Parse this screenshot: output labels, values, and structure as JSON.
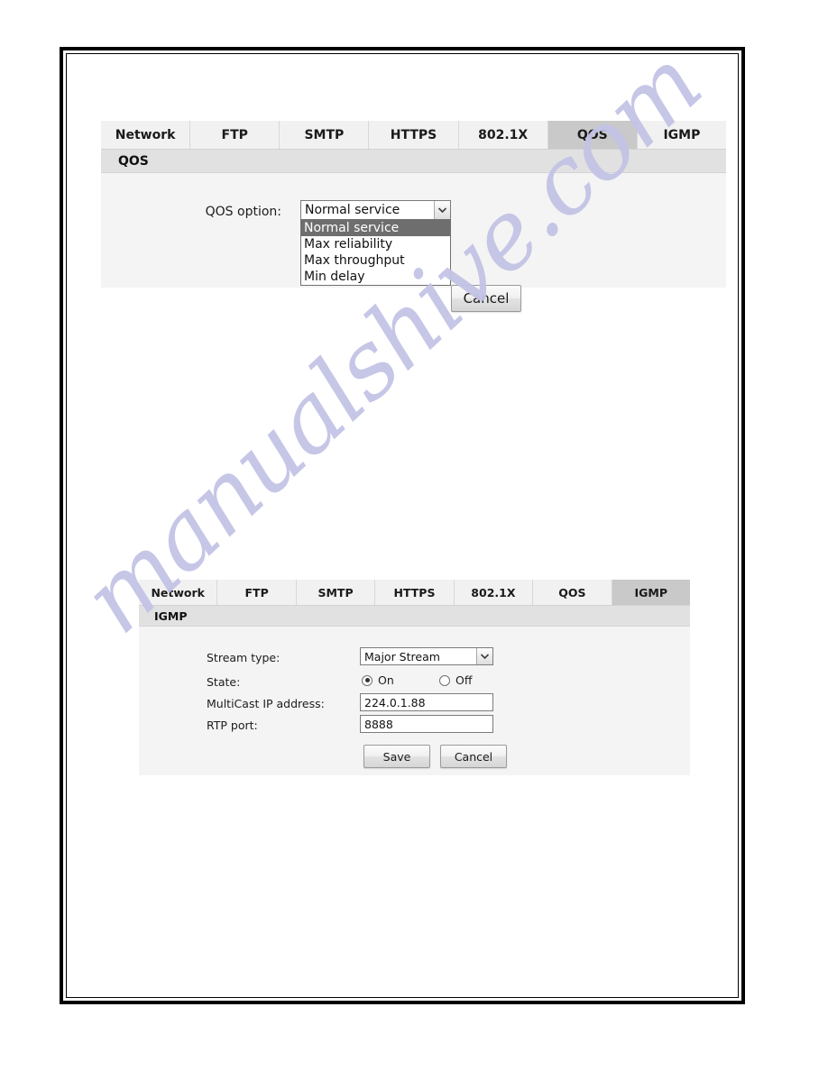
{
  "page": {
    "watermark_text": "manualshive.com",
    "watermark_color": "#c3c3e6"
  },
  "tabs": [
    "Network",
    "FTP",
    "SMTP",
    "HTTPS",
    "802.1X",
    "QOS",
    "IGMP"
  ],
  "qos_panel": {
    "active_tab": "QOS",
    "section_title": "QOS",
    "option_label": "QOS option:",
    "select_value": "Normal service",
    "dropdown_open": true,
    "dropdown_options": [
      "Normal service",
      "Max reliability",
      "Max throughput",
      "Min delay"
    ],
    "dropdown_selected": "Normal service",
    "cancel_label": "Cancel"
  },
  "igmp_panel": {
    "active_tab": "IGMP",
    "section_title": "IGMP",
    "stream_type_label": "Stream type:",
    "stream_type_value": "Major Stream",
    "state_label": "State:",
    "state_on_label": "On",
    "state_off_label": "Off",
    "state_selected": "On",
    "multicast_label": "MultiCast IP address:",
    "multicast_value": "224.0.1.88",
    "rtp_label": "RTP port:",
    "rtp_value": "8888",
    "save_label": "Save",
    "cancel_label": "Cancel"
  }
}
